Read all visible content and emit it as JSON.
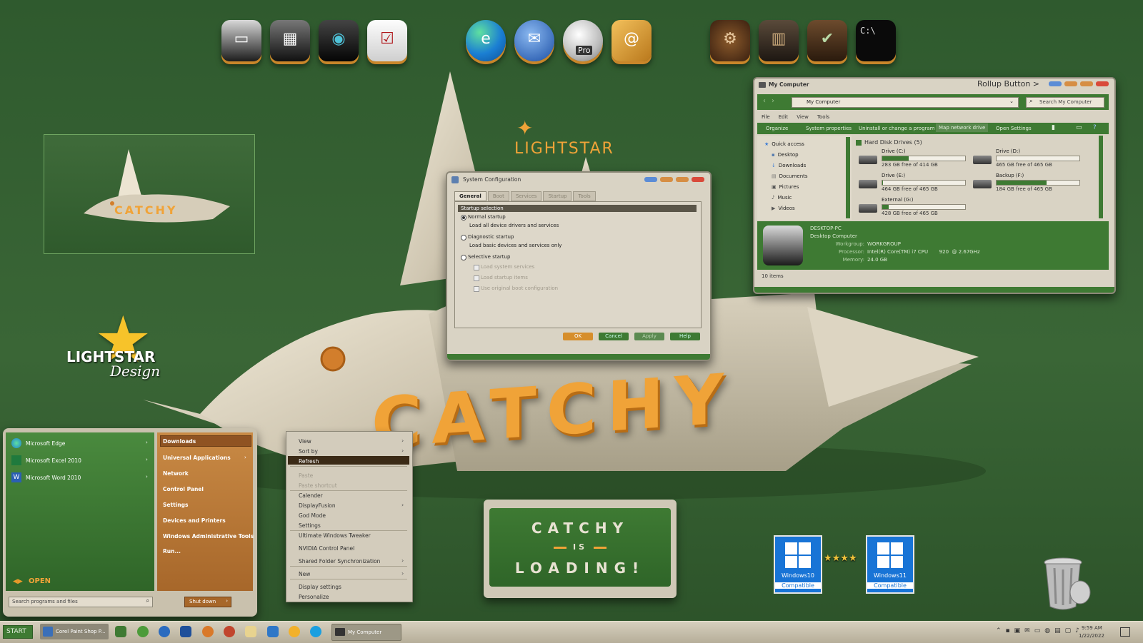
{
  "brand": {
    "lightstar_top": "LIGHTSTAR",
    "lightstar_logo_word": "LIGHTSTAR",
    "lightstar_logo_sub": "Design",
    "preview_word": "CATCHY",
    "sculpture_word": "CATCHY",
    "accent_orange": "#e89a2a",
    "bg_green": "#3a6636"
  },
  "dock": {
    "group1": [
      "monitor-icon",
      "device-manager-icon",
      "network-icon",
      "checklist-icon"
    ],
    "group2": [
      "edge-icon",
      "thunderbird-icon",
      "earth-pro-icon",
      "address-book-icon"
    ],
    "group2_pro_label": "Pro",
    "group3": [
      "settings-gear-icon",
      "book-icon",
      "security-check-icon",
      "cmd-icon"
    ],
    "cmd_label": "C:\\"
  },
  "sysconfig": {
    "title": "System Configuration",
    "tabs": [
      "General",
      "Boot",
      "Services",
      "Startup",
      "Tools"
    ],
    "section": "Startup selection",
    "normal": "Normal startup",
    "normal_desc": "Load all device drivers and services",
    "diagnostic": "Diagnostic startup",
    "diagnostic_desc": "Load basic devices and services only",
    "selective": "Selective startup",
    "chk1": "Load system services",
    "chk2": "Load startup items",
    "chk3": "Use original boot configuration",
    "ok": "OK",
    "cancel": "Cancel",
    "apply": "Apply",
    "help": "Help"
  },
  "mycomputer": {
    "title": "My Computer",
    "rollup": "Rollup Button >",
    "address": "My Computer",
    "search_placeholder": "Search My Computer",
    "menu": [
      "File",
      "Edit",
      "View",
      "Tools"
    ],
    "toolbar": [
      "Organize",
      "System properties",
      "Uninstall or change a program",
      "Map network drive",
      "Open Settings"
    ],
    "nav": [
      "Quick access",
      "Desktop",
      "Downloads",
      "Documents",
      "Pictures",
      "Music",
      "Videos"
    ],
    "group": "Hard Disk Drives (5)",
    "drives": [
      {
        "name": "Drive (C:)",
        "free": "283 GB free of 414 GB",
        "fill": 0.32
      },
      {
        "name": "Drive (D:)",
        "free": "465 GB free of 465 GB",
        "fill": 0.0
      },
      {
        "name": "Drive (E:)",
        "free": "464 GB free of 465 GB",
        "fill": 0.01
      },
      {
        "name": "Backup (F:)",
        "free": "184 GB free of 465 GB",
        "fill": 0.6
      },
      {
        "name": "External (G:)",
        "free": "428 GB free of 465 GB",
        "fill": 0.08
      }
    ],
    "pc_name": "DESKTOP-PC",
    "pc_type": "Desktop Computer",
    "workgroup_label": "Workgroup:",
    "workgroup": "WORKGROUP",
    "processor_label": "Processor:",
    "processor": "Intel(R) Core(TM) i7 CPU       920  @ 2.67GHz",
    "memory_label": "Memory:",
    "memory": "24.0 GB",
    "status": "10 items"
  },
  "startmenu": {
    "pinned": [
      "Microsoft Edge",
      "Microsoft Excel 2010",
      "Microsoft Word 2010"
    ],
    "right": [
      "Downloads",
      "Universal Applications",
      "Network",
      "Control Panel",
      "Settings",
      "Devices and Printers",
      "Windows Administrative Tools",
      "Run..."
    ],
    "open_label": "OPEN",
    "search_placeholder": "Search programs and files",
    "shutdown": "Shut down"
  },
  "contextmenu": {
    "items": [
      {
        "label": "View",
        "arrow": true,
        "disabled": false
      },
      {
        "label": "Sort by",
        "arrow": true,
        "disabled": false
      },
      {
        "label": "Refresh",
        "arrow": false,
        "disabled": false
      },
      {
        "label": "Paste",
        "arrow": false,
        "disabled": true
      },
      {
        "label": "Paste shortcut",
        "arrow": false,
        "disabled": true
      },
      {
        "label": "Calender",
        "arrow": false,
        "disabled": false
      },
      {
        "label": "DisplayFusion",
        "arrow": true,
        "disabled": false
      },
      {
        "label": "God Mode",
        "arrow": false,
        "disabled": false
      },
      {
        "label": "Settings",
        "arrow": false,
        "disabled": false
      },
      {
        "label": "Ultimate Windows Tweaker",
        "arrow": false,
        "disabled": false
      },
      {
        "label": "NVIDIA Control Panel",
        "arrow": false,
        "disabled": false
      },
      {
        "label": "Shared Folder Synchronization",
        "arrow": true,
        "disabled": false
      },
      {
        "label": "New",
        "arrow": true,
        "disabled": false
      },
      {
        "label": "Display settings",
        "arrow": false,
        "disabled": false
      },
      {
        "label": "Personalize",
        "arrow": false,
        "disabled": false
      }
    ]
  },
  "loading": {
    "line1": "CATCHY",
    "line2": "IS",
    "line3": "LOADING!"
  },
  "badges": {
    "win10_line1": "Windows10",
    "win10_line2": "Compatible",
    "win11_line1": "Windows11",
    "win11_line2": "Compatible"
  },
  "taskbar": {
    "start": "START",
    "app1": "Corel Paint Shop P...",
    "app2": "My Computer",
    "time": "9:59 AM",
    "date": "1/22/2022"
  }
}
